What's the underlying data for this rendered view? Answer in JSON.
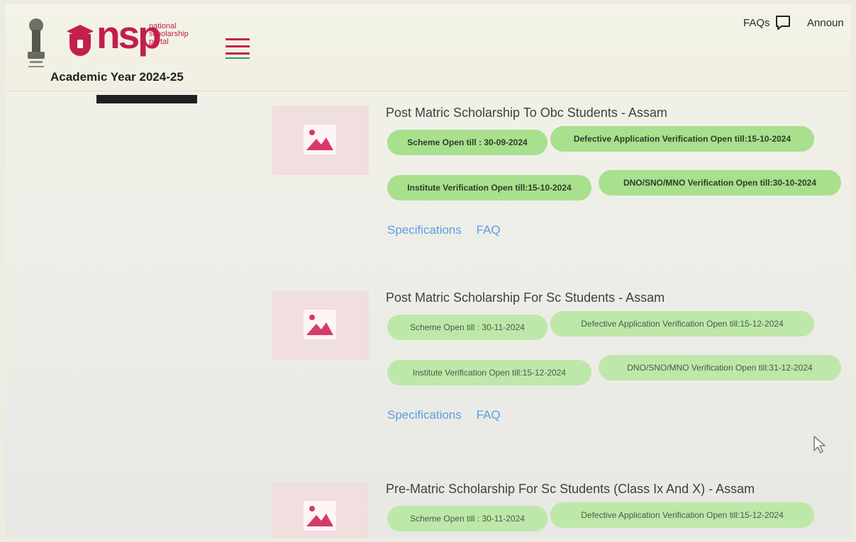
{
  "header": {
    "logo": {
      "wordmark": "nsp",
      "subtext": [
        "national",
        "scholarship",
        "portal"
      ]
    },
    "academic_year": "Academic Year 2024-25",
    "links": {
      "faqs": "FAQs",
      "announcements": "Announ"
    },
    "icons": {
      "emblem": "national-emblem",
      "menu": "hamburger-menu",
      "faq_chat": "chat-square"
    }
  },
  "schemes": [
    {
      "title": "Post Matric Scholarship To Obc Students - Assam",
      "chips": [
        "Scheme Open till : 30-09-2024",
        "Defective Application Verification Open till:15-10-2024",
        "Institute Verification Open till:15-10-2024",
        "DNO/SNO/MNO Verification Open till:30-10-2024"
      ],
      "links": [
        "Specifications",
        "FAQ"
      ],
      "image_icon": "image-placeholder"
    },
    {
      "title": "Post Matric Scholarship For Sc Students - Assam",
      "chips": [
        "Scheme Open till : 30-11-2024",
        "Defective Application Verification Open till:15-12-2024",
        "Institute Verification Open till:15-12-2024",
        "DNO/SNO/MNO Verification Open till:31-12-2024"
      ],
      "links": [
        "Specifications",
        "FAQ"
      ],
      "image_icon": "image-placeholder"
    },
    {
      "title": "Pre-Matric Scholarship For Sc Students (Class Ix And X) - Assam",
      "chips": [
        "Scheme Open till : 30-11-2024",
        "Defective Application Verification Open till:15-12-2024"
      ],
      "image_icon": "image-placeholder"
    }
  ],
  "colors": {
    "brand": "#c21f4b",
    "chip_green": "#a8e08e",
    "link_blue": "#5b9fe3"
  }
}
